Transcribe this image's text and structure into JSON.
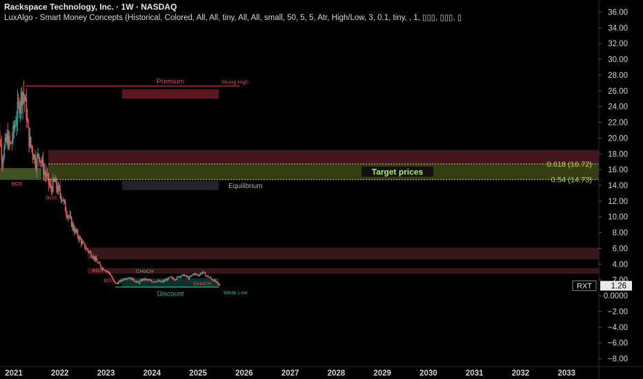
{
  "header": {
    "title": "Rackspace Technology, Inc. · 1W · NASDAQ",
    "indicator": "LuxAlgo - Smart Money Concepts (Historical, Colored, All, All, tiny, All, All, small, 50, 5, 5, Atr, High/Low, 3, 0.1, tiny, , 1, ▯▯▯, ▯▯▯, ▯"
  },
  "chart_data": {
    "type": "candlestick",
    "symbol": "RXT",
    "last_price": "1.26",
    "ylim": [
      -9,
      37
    ],
    "y_ticks": [
      "36.00",
      "34.00",
      "32.00",
      "30.00",
      "28.00",
      "26.00",
      "24.00",
      "22.00",
      "20.00",
      "18.00",
      "16.00",
      "14.00",
      "12.00",
      "10.00",
      "8.00",
      "6.00",
      "4.00",
      "2.00",
      "0.0000",
      "−2.00",
      "−4.00",
      "−6.00",
      "−8.00"
    ],
    "y_tick_values": [
      36,
      34,
      32,
      30,
      28,
      26,
      24,
      22,
      20,
      18,
      16,
      14,
      12,
      10,
      8,
      6,
      4,
      2,
      0,
      -2,
      -4,
      -6,
      -8
    ],
    "xlim": [
      2020.7,
      2033.7
    ],
    "x_ticks": [
      "2021",
      "2022",
      "2023",
      "2024",
      "2025",
      "2026",
      "2027",
      "2028",
      "2029",
      "2030",
      "2031",
      "2032",
      "2033"
    ],
    "x_tick_values": [
      2021,
      2022,
      2023,
      2024,
      2025,
      2026,
      2027,
      2028,
      2029,
      2030,
      2031,
      2032,
      2033
    ],
    "price_path": [
      [
        2020.6,
        18.5
      ],
      [
        2020.68,
        20.5
      ],
      [
        2020.75,
        17.5
      ],
      [
        2020.85,
        20.0
      ],
      [
        2020.93,
        19.0
      ],
      [
        2021.05,
        22.5
      ],
      [
        2021.12,
        24.5
      ],
      [
        2021.2,
        26.0
      ],
      [
        2021.27,
        23.5
      ],
      [
        2021.32,
        20.0
      ],
      [
        2021.4,
        18.5
      ],
      [
        2021.48,
        17.0
      ],
      [
        2021.56,
        18.0
      ],
      [
        2021.64,
        16.0
      ],
      [
        2021.72,
        15.0
      ],
      [
        2021.8,
        13.5
      ],
      [
        2021.88,
        14.5
      ],
      [
        2021.95,
        13.5
      ],
      [
        2022.05,
        12.5
      ],
      [
        2022.12,
        11.0
      ],
      [
        2022.2,
        10.0
      ],
      [
        2022.3,
        8.5
      ],
      [
        2022.4,
        7.5
      ],
      [
        2022.5,
        6.5
      ],
      [
        2022.6,
        5.8
      ],
      [
        2022.72,
        5.0
      ],
      [
        2022.82,
        4.2
      ],
      [
        2022.9,
        3.6
      ],
      [
        2023.0,
        3.2
      ],
      [
        2023.08,
        2.8
      ],
      [
        2023.15,
        2.0
      ],
      [
        2023.22,
        1.5
      ],
      [
        2023.3,
        1.8
      ],
      [
        2023.4,
        2.2
      ],
      [
        2023.5,
        2.3
      ],
      [
        2023.6,
        2.0
      ],
      [
        2023.7,
        1.6
      ],
      [
        2023.8,
        2.1
      ],
      [
        2023.9,
        2.0
      ],
      [
        2024.0,
        1.8
      ],
      [
        2024.1,
        1.9
      ],
      [
        2024.2,
        1.7
      ],
      [
        2024.3,
        2.0
      ],
      [
        2024.4,
        2.3
      ],
      [
        2024.5,
        2.1
      ],
      [
        2024.6,
        2.5
      ],
      [
        2024.7,
        2.6
      ],
      [
        2024.8,
        2.2
      ],
      [
        2024.9,
        2.8
      ],
      [
        2025.0,
        2.6
      ],
      [
        2025.1,
        3.0
      ],
      [
        2025.18,
        2.5
      ],
      [
        2025.25,
        2.3
      ],
      [
        2025.35,
        1.9
      ],
      [
        2025.42,
        1.5
      ],
      [
        2025.48,
        1.26
      ]
    ],
    "zones": [
      {
        "label": "Premium",
        "x0": 2023.35,
        "x1": 2025.45,
        "y0": 25.0,
        "y1": 26.2,
        "color": "#7a1f2b"
      },
      {
        "label": "Equilibrium",
        "x0": 2023.35,
        "x1": 2025.45,
        "y0": 13.4,
        "y1": 14.6,
        "color": "#2e2e34"
      },
      {
        "label": "Discount",
        "x0": 2023.35,
        "x1": 2025.45,
        "y0": 1.0,
        "y1": 2.2,
        "color": "#16403a"
      },
      {
        "label": "",
        "x0": 2020.7,
        "x1": 2021.6,
        "y0": 14.7,
        "y1": 16.2,
        "color": "#556b2f"
      },
      {
        "label": "",
        "x0": 2021.75,
        "x1": 2033.7,
        "y0": 16.7,
        "y1": 18.5,
        "color": "#5a1f27"
      },
      {
        "label": "",
        "x0": 2021.75,
        "x1": 2033.7,
        "y0": 14.73,
        "y1": 16.72,
        "color": "#4a5119"
      },
      {
        "label": "",
        "x0": 2022.6,
        "x1": 2033.7,
        "y0": 4.6,
        "y1": 6.1,
        "color": "#4a1e26"
      },
      {
        "label": "",
        "x0": 2022.6,
        "x1": 2033.7,
        "y0": 2.8,
        "y1": 3.5,
        "color": "#4a1e26"
      }
    ],
    "levels": [
      {
        "label": "0.618 (16.72)",
        "value": 16.72,
        "color": "#b6d957"
      },
      {
        "label": "0.54 (14.73)",
        "value": 14.73,
        "color": "#b6d957"
      }
    ],
    "target_label": "Target prices",
    "annotations": [
      {
        "text": "Strong High",
        "x": 2025.5,
        "y": 26.9,
        "color": "#e0505a"
      },
      {
        "text": "Weak Low",
        "x": 2025.55,
        "y": 0.2,
        "color": "#41b28a"
      },
      {
        "text": "BOS",
        "x": 2020.95,
        "y": 14.0,
        "color": "#e0505a"
      },
      {
        "text": "BOS",
        "x": 2021.7,
        "y": 12.2,
        "color": "#e0505a"
      },
      {
        "text": "BOS",
        "x": 2022.7,
        "y": 3.0,
        "color": "#e0505a"
      },
      {
        "text": "BOS",
        "x": 2022.95,
        "y": 1.7,
        "color": "#e0505a"
      },
      {
        "text": "CHoCH",
        "x": 2023.65,
        "y": 2.9,
        "color": "#41b28a"
      },
      {
        "text": "CHoCH",
        "x": 2024.9,
        "y": 1.3,
        "color": "#e0505a"
      }
    ],
    "strong_high": 26.6,
    "weak_low": 1.1,
    "colors": {
      "up": "#26a69a",
      "down": "#ef5350",
      "background": "#000000",
      "axis_text": "#d1d4dc"
    }
  }
}
